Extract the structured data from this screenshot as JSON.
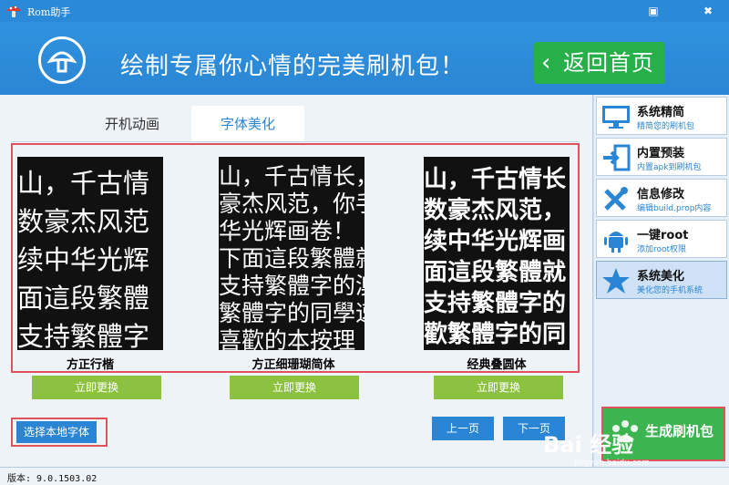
{
  "app": {
    "title": "Rom助手"
  },
  "banner": {
    "slogan": "绘制专属你心情的完美刷机包！",
    "back_label": "返回首页"
  },
  "tabs": [
    {
      "label": "开机动画"
    },
    {
      "label": "字体美化"
    }
  ],
  "fonts": [
    {
      "name": "方正行楷",
      "preview_lines": [
        "山，千古情",
        "数豪杰风范",
        "续中华光辉",
        "面這段繁體",
        "支持繁體字"
      ]
    },
    {
      "name": "方正细珊瑚简体",
      "preview_lines": [
        "山，千古情长，",
        "豪杰风范，你手",
        "华光辉画卷！",
        "下面這段繁體就",
        "支持繁體字的澳",
        "繁體字的同學速",
        "喜歡的本按理"
      ]
    },
    {
      "name": "经典叠圆体",
      "preview_lines": [
        "山，千古情长",
        "数豪杰风范，",
        "续中华光辉画",
        "面這段繁體就",
        "支持繁體字的",
        "歡繁體字的同"
      ]
    }
  ],
  "apply_label": "立即更换",
  "local_font_label": "选择本地字体",
  "pager": {
    "prev": "上一页",
    "next": "下一页"
  },
  "sidebar": {
    "items": [
      {
        "title": "系统精简",
        "subtitle": "精简您的刷机包",
        "icon": "monitor-icon"
      },
      {
        "title": "内置预装",
        "subtitle": "内置apk到刷机包",
        "icon": "import-arrow-icon"
      },
      {
        "title": "信息修改",
        "subtitle": "编辑build.prop内容",
        "icon": "tools-icon"
      },
      {
        "title": "一键root",
        "subtitle": "添加root权限",
        "icon": "android-icon"
      },
      {
        "title": "系统美化",
        "subtitle": "美化您的手机系统",
        "icon": "star-icon"
      }
    ],
    "green_button_label": "生成刷机包"
  },
  "watermark": {
    "text": "Bai 经验",
    "url": "jingyan.baidu.com",
    "site": "www.yzmg.com"
  },
  "status": {
    "version": "版本: 9.0.1503.02"
  },
  "colors": {
    "titlebar": "#2a8ad8",
    "banner": "#2f92de",
    "back_button": "#27b04a",
    "apply_button": "#8cc23f",
    "primary_button": "#2a86d4",
    "highlight_border": "#e0535a"
  }
}
